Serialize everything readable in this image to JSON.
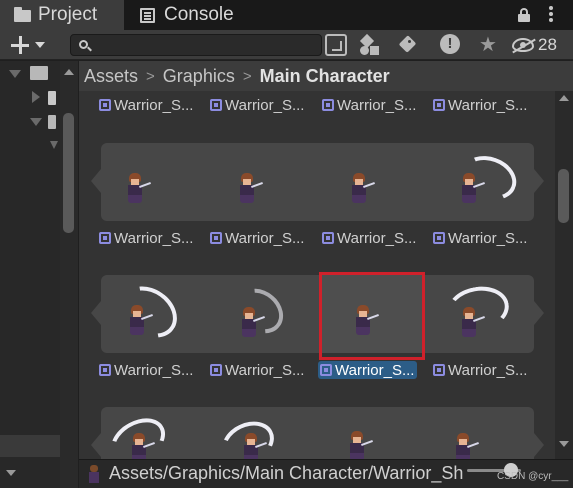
{
  "tabs": [
    {
      "label": "Project",
      "icon": "folder-icon",
      "active": true
    },
    {
      "label": "Console",
      "icon": "console-icon",
      "active": false
    }
  ],
  "toolbar": {
    "search_value": "",
    "hidden_packages_count": "28"
  },
  "breadcrumb": [
    "Assets",
    "Graphics",
    "Main Character"
  ],
  "breadcrumb_separator": ">",
  "grid": {
    "rows": [
      {
        "labels": [
          "Warrior_S...",
          "Warrior_S...",
          "Warrior_S...",
          "Warrior_S..."
        ]
      },
      {
        "labels": [
          "Warrior_S...",
          "Warrior_S...",
          "Warrior_S...",
          "Warrior_S..."
        ]
      },
      {
        "labels": [
          "Warrior_S...",
          "Warrior_S...",
          "Warrior_S...",
          "Warrior_S..."
        ]
      }
    ],
    "selected": {
      "row": 2,
      "col": 2
    }
  },
  "status": {
    "path": "Assets/Graphics/Main Character/Warrior_SheetnoEffect_26",
    "watermark": "CSDN @cyr___"
  },
  "colors": {
    "selection": "#2c5d87",
    "highlight_box": "#d0212b",
    "sprite_group_bg": "#474747"
  }
}
